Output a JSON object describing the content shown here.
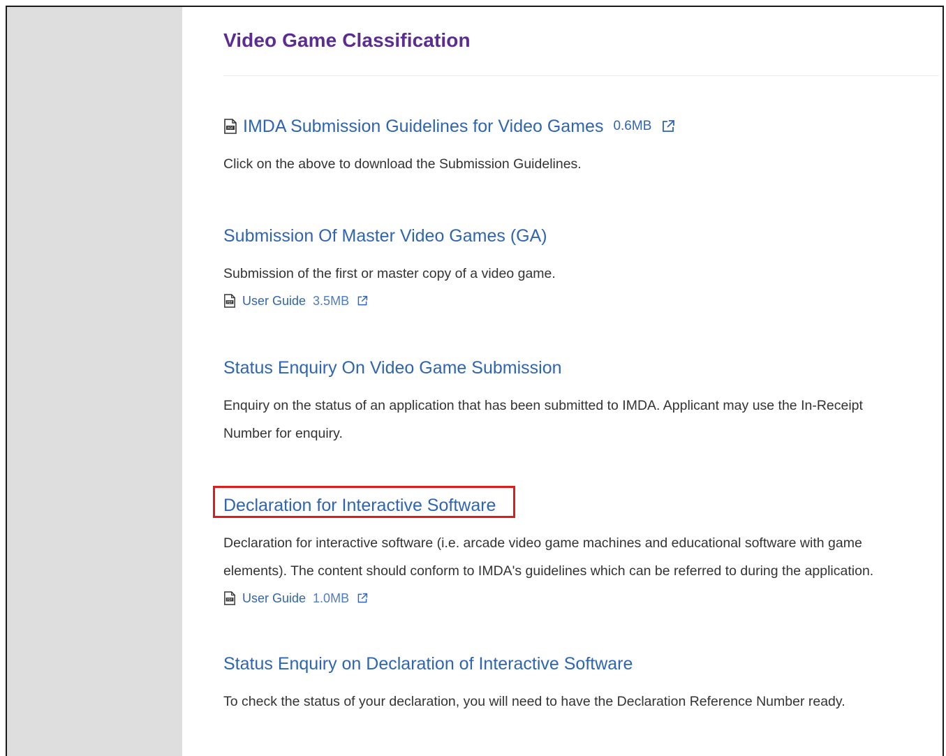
{
  "page": {
    "title": "Video Game Classification"
  },
  "sections": [
    {
      "heading": "IMDA Submission Guidelines for Video Games",
      "size": "0.6MB",
      "description": "Click on the above to download the Submission Guidelines."
    },
    {
      "heading": "Submission Of Master Video Games (GA)",
      "description": "Submission of the first or master copy of a video game.",
      "guide_label": "User Guide",
      "guide_size": "3.5MB"
    },
    {
      "heading": "Status Enquiry On Video Game Submission",
      "description_line1": "Enquiry on the status of an application that has been submitted to IMDA. Applicant may use the In-Receipt",
      "description_line2": "Number for enquiry."
    },
    {
      "heading": "Declaration for Interactive Software",
      "description_line1": "Declaration for interactive software (i.e. arcade video game machines and educational software with game",
      "description_line2": "elements). The content should conform to IMDA's guidelines which can be referred to during the application.",
      "guide_label": "User Guide",
      "guide_size": "1.0MB",
      "highlighted": true
    },
    {
      "heading": "Status Enquiry on Declaration of Interactive Software",
      "description": "To check the status of your declaration, you will need to have the Declaration Reference Number ready."
    }
  ],
  "icons": {
    "pdf": "pdf-file-icon",
    "external": "external-link-icon"
  },
  "colors": {
    "title": "#5b2d91",
    "link": "#2f65b0",
    "body_text": "#333333",
    "sidebar": "#dedede",
    "highlight": "#e01b1b"
  }
}
